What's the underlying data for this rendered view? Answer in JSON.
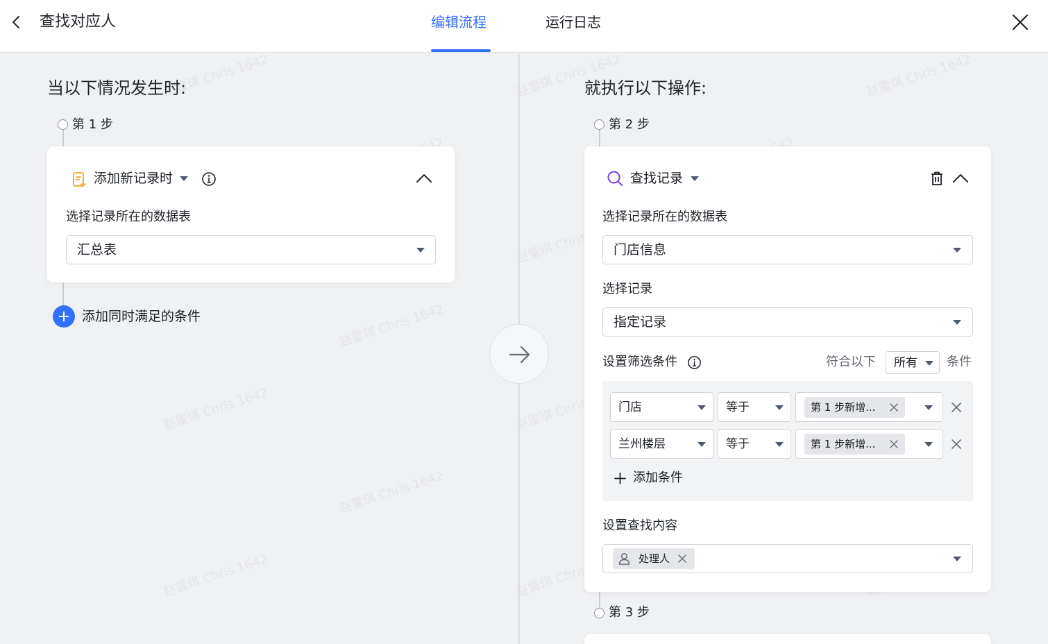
{
  "header": {
    "title": "查找对应人",
    "tabs": [
      {
        "label": "编辑流程",
        "active": true
      },
      {
        "label": "运行日志",
        "active": false
      }
    ]
  },
  "left": {
    "section_title": "当以下情况发生时:",
    "step_label": "第 1 步",
    "trigger": {
      "label": "添加新记录时",
      "table_field_label": "选择记录所在的数据表",
      "table_value": "汇总表"
    },
    "add_condition_label": "添加同时满足的条件"
  },
  "right": {
    "section_title": "就执行以下操作:",
    "step2_label": "第 2 步",
    "step3_label": "第 3 步",
    "action": {
      "label": "查找记录",
      "table_field_label": "选择记录所在的数据表",
      "table_value": "门店信息",
      "record_field_label": "选择记录",
      "record_value": "指定记录",
      "filter_label": "设置筛选条件",
      "match_prefix": "符合以下",
      "match_value": "所有",
      "match_suffix": "条件",
      "conditions": [
        {
          "field": "门店",
          "operator": "等于",
          "value_tag": "第 1 步新增..."
        },
        {
          "field": "兰州楼层",
          "operator": "等于",
          "value_tag": "第 1 步新增..."
        }
      ],
      "add_condition_label": "添加条件",
      "find_content_label": "设置查找内容",
      "find_content_tag": "处理人"
    }
  },
  "watermark_text": "赵雷琪 Chris 1642",
  "colors": {
    "accent": "#3370ff",
    "trigger_icon": "#f5a623",
    "search_icon": "#7b3ff2"
  }
}
